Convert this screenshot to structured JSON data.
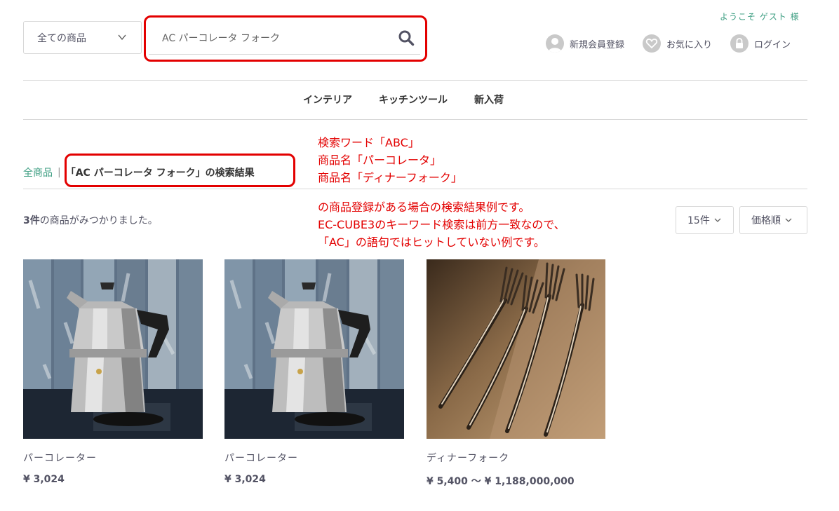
{
  "header": {
    "category_select": "全ての商品",
    "search_value": "AC パーコレータ フォーク",
    "welcome": "ようこそ ゲスト 様",
    "links": [
      {
        "label": "新規会員登録",
        "icon": "user-icon"
      },
      {
        "label": "お気に入り",
        "icon": "heart-icon"
      },
      {
        "label": "ログイン",
        "icon": "lock-icon"
      }
    ]
  },
  "nav": [
    "インテリア",
    "キッチンツール",
    "新入荷"
  ],
  "breadcrumb": {
    "home": "全商品",
    "separator": "|",
    "current": "「AC パーコレータ フォーク」の検索結果"
  },
  "annotation": {
    "lines_top": [
      "検索ワード「ABC」",
      "商品名「パーコレータ」",
      "商品名「ディナーフォーク」"
    ],
    "lines_bottom": [
      "の商品登録がある場合の検索結果例です。",
      "EC-CUBE3のキーワード検索は前方一致なので、",
      "「AC」の語句ではヒットしていない例です。"
    ],
    "color": "#e30000"
  },
  "results": {
    "count": "3件",
    "count_suffix": "の商品がみつかりました。",
    "per_page": "15件",
    "order": "価格順"
  },
  "products": [
    {
      "name": "パーコレーター",
      "price": "¥ 3,024",
      "image": "coffee-percolator"
    },
    {
      "name": "パーコレーター",
      "price": "¥ 3,024",
      "image": "coffee-percolator"
    },
    {
      "name": "ディナーフォーク",
      "price": "¥ 5,400 ～ ¥ 1,188,000,000",
      "image": "dinner-forks"
    }
  ],
  "colors": {
    "accent": "#3d9e82",
    "text": "#525263",
    "highlight": "#e30000"
  }
}
